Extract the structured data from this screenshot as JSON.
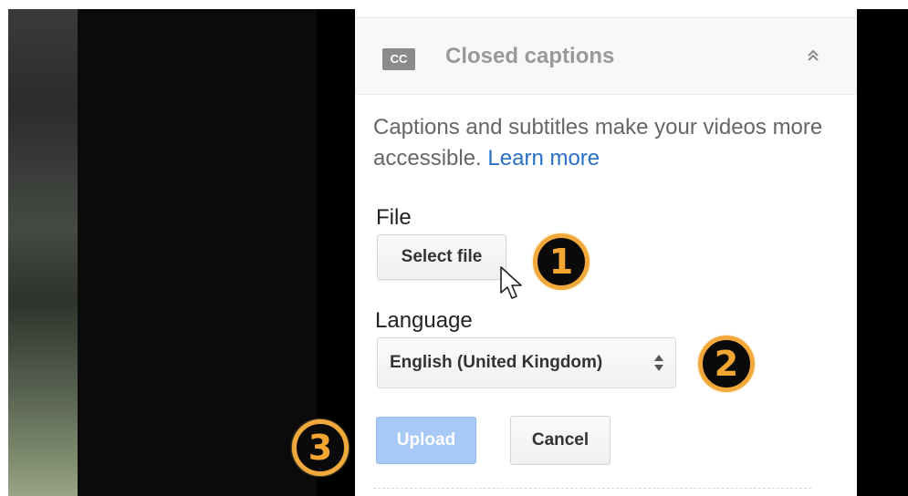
{
  "panel": {
    "header": {
      "badge": "CC",
      "title": "Closed captions",
      "collapse_icon": "chevron-double-up-icon"
    },
    "description": {
      "text": "Captions and subtitles make your videos more accessible.",
      "link": "Learn more"
    },
    "file": {
      "label": "File",
      "button": "Select file"
    },
    "language": {
      "label": "Language",
      "selected": "English (United Kingdom)"
    },
    "actions": {
      "upload": "Upload",
      "cancel": "Cancel"
    }
  },
  "steps": [
    "1",
    "2",
    "3"
  ],
  "colors": {
    "step_accent": "#f2a93b",
    "link": "#2a6fc6",
    "upload_disabled": "#a8c8f5"
  }
}
